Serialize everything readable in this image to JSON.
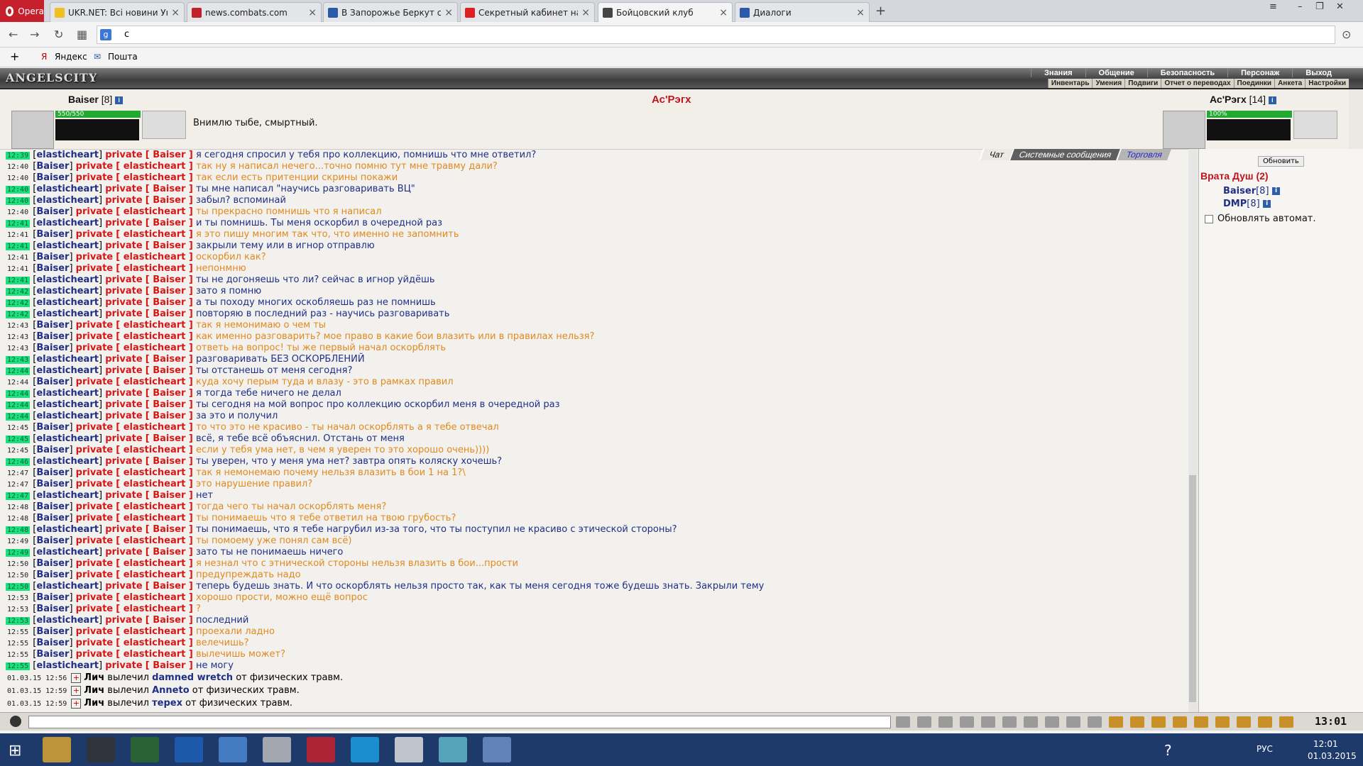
{
  "browser": {
    "opera_label": "Opera",
    "tabs": [
      {
        "title": "UKR.NET: Всі новини Укр",
        "color": "#f0c020"
      },
      {
        "title": "news.combats.com",
        "color": "#c0202a"
      },
      {
        "title": "В Запорожье Беркут с ав",
        "color": "#2c5aa8"
      },
      {
        "title": "Секретный кабинет нача",
        "color": "#e02020"
      },
      {
        "title": "Бойцовский клуб",
        "color": "#444444"
      },
      {
        "title": "Диалоги",
        "color": "#2c5aa8"
      }
    ],
    "url": "c",
    "bookmarks": [
      "Яндекс",
      "Пошта"
    ]
  },
  "game": {
    "logo": "ANGELSCITY",
    "menu_top": [
      "Знания",
      "Общение",
      "Безопасность",
      "Персонаж",
      "Выход"
    ],
    "menu_bottom": [
      "Инвентарь",
      "Умения",
      "Подвиги",
      "Отчет о переводах",
      "Поединки",
      "Анкета",
      "Настройки"
    ],
    "player": {
      "name": "Baiser",
      "level": "[8]",
      "hp": "550/550",
      "hp_fraction": 1.0
    },
    "opponent": {
      "name": "Ас'Рэгх",
      "level": "[14]",
      "hp": "100%",
      "hp_fraction": 1.0
    },
    "quote": "Внимлю тыбе, смыртный."
  },
  "chat": {
    "tabs": [
      "Чат",
      "Системные сообщения",
      "Торговля"
    ],
    "lines": [
      {
        "t": "12:39",
        "g": true,
        "from": "elasticheart",
        "to": "Baiser",
        "text": "я сегодня спросил у тебя про коллекцию, помнишь что мне ответил?"
      },
      {
        "t": "12:40",
        "g": false,
        "from": "Baiser",
        "to": "elasticheart",
        "text": "так ну я написал нечего...точно помню тут мне травму дали?"
      },
      {
        "t": "12:40",
        "g": false,
        "from": "Baiser",
        "to": "elasticheart",
        "text": "так если есть притенции скрины покажи"
      },
      {
        "t": "12:40",
        "g": true,
        "from": "elasticheart",
        "to": "Baiser",
        "text": "ты мне написал \"научись разговаривать ВЦ\""
      },
      {
        "t": "12:40",
        "g": true,
        "from": "elasticheart",
        "to": "Baiser",
        "text": "забыл? вспоминай"
      },
      {
        "t": "12:40",
        "g": false,
        "from": "Baiser",
        "to": "elasticheart",
        "text": "ты прекрасно помнишь что я написал"
      },
      {
        "t": "12:41",
        "g": true,
        "from": "elasticheart",
        "to": "Baiser",
        "text": "и ты помнишь. Ты меня оскорбил в очередной раз"
      },
      {
        "t": "12:41",
        "g": false,
        "from": "Baiser",
        "to": "elasticheart",
        "text": "я это пишу многим так что, что именно не запомнить"
      },
      {
        "t": "12:41",
        "g": true,
        "from": "elasticheart",
        "to": "Baiser",
        "text": "закрыли тему или в игнор отправлю"
      },
      {
        "t": "12:41",
        "g": false,
        "from": "Baiser",
        "to": "elasticheart",
        "text": "оскорбил как?"
      },
      {
        "t": "12:41",
        "g": false,
        "from": "Baiser",
        "to": "elasticheart",
        "text": "непонмню"
      },
      {
        "t": "12:41",
        "g": true,
        "from": "elasticheart",
        "to": "Baiser",
        "text": "ты не догоняешь что ли? сейчас в игнор уйдёшь"
      },
      {
        "t": "12:42",
        "g": true,
        "from": "elasticheart",
        "to": "Baiser",
        "text": "зато я помню"
      },
      {
        "t": "12:42",
        "g": true,
        "from": "elasticheart",
        "to": "Baiser",
        "text": "а ты походу многих оскобляешь раз не помнишь"
      },
      {
        "t": "12:42",
        "g": true,
        "from": "elasticheart",
        "to": "Baiser",
        "text": "повторяю в последний раз - научись разговаривать"
      },
      {
        "t": "12:43",
        "g": false,
        "from": "Baiser",
        "to": "elasticheart",
        "text": "так я немонимаю о чем ты"
      },
      {
        "t": "12:43",
        "g": false,
        "from": "Baiser",
        "to": "elasticheart",
        "text": "как именно разговарить? мое право в какие бои влазить или в правилах нельзя?"
      },
      {
        "t": "12:43",
        "g": false,
        "from": "Baiser",
        "to": "elasticheart",
        "text": "ответь на вопрос! ты же первый начал оскорблять"
      },
      {
        "t": "12:43",
        "g": true,
        "from": "elasticheart",
        "to": "Baiser",
        "text": "разговаривать БЕЗ ОСКОРБЛЕНИЙ"
      },
      {
        "t": "12:44",
        "g": true,
        "from": "elasticheart",
        "to": "Baiser",
        "text": "ты отстанешь от меня сегодня?"
      },
      {
        "t": "12:44",
        "g": false,
        "from": "Baiser",
        "to": "elasticheart",
        "text": "куда хочу перым туда и влазу - это в рамках правил"
      },
      {
        "t": "12:44",
        "g": true,
        "from": "elasticheart",
        "to": "Baiser",
        "text": "я тогда тебе ничего не делал"
      },
      {
        "t": "12:44",
        "g": true,
        "from": "elasticheart",
        "to": "Baiser",
        "text": "ты сегодня на мой вопрос про коллекцию оскорбил меня в очередной раз"
      },
      {
        "t": "12:44",
        "g": true,
        "from": "elasticheart",
        "to": "Baiser",
        "text": "за это и получил"
      },
      {
        "t": "12:45",
        "g": false,
        "from": "Baiser",
        "to": "elasticheart",
        "text": "то что это не красиво - ты начал оскорблять а я тебе отвечал"
      },
      {
        "t": "12:45",
        "g": true,
        "from": "elasticheart",
        "to": "Baiser",
        "text": "всё, я тебе всё объяснил. Отстань от меня"
      },
      {
        "t": "12:45",
        "g": false,
        "from": "Baiser",
        "to": "elasticheart",
        "text": "если у тебя ума нет, в чем я уверен то это хорошо очень))))"
      },
      {
        "t": "12:46",
        "g": true,
        "from": "elasticheart",
        "to": "Baiser",
        "text": "ты уверен, что у меня ума нет? завтра опять коляску хочешь?"
      },
      {
        "t": "12:47",
        "g": false,
        "from": "Baiser",
        "to": "elasticheart",
        "text": "так я немонемаю почему нельзя влазить в бои 1 на 1?\\"
      },
      {
        "t": "12:47",
        "g": false,
        "from": "Baiser",
        "to": "elasticheart",
        "text": "это нарушение правил?"
      },
      {
        "t": "12:47",
        "g": true,
        "from": "elasticheart",
        "to": "Baiser",
        "text": "нет"
      },
      {
        "t": "12:48",
        "g": false,
        "from": "Baiser",
        "to": "elasticheart",
        "text": "тогда чего ты начал оскорблять меня?"
      },
      {
        "t": "12:48",
        "g": false,
        "from": "Baiser",
        "to": "elasticheart",
        "text": "ты понимаешь что я тебе ответил на твою грубость?"
      },
      {
        "t": "12:48",
        "g": true,
        "from": "elasticheart",
        "to": "Baiser",
        "text": "ты понимаешь, что я тебе нагрубил из-за того, что ты поступил не красиво с этической стороны?"
      },
      {
        "t": "12:49",
        "g": false,
        "from": "Baiser",
        "to": "elasticheart",
        "text": "ты помоему уже понял сам всё)"
      },
      {
        "t": "12:49",
        "g": true,
        "from": "elasticheart",
        "to": "Baiser",
        "text": "зато ты не понимаешь ничего"
      },
      {
        "t": "12:50",
        "g": false,
        "from": "Baiser",
        "to": "elasticheart",
        "text": "я незнал что с этнической стороны нельзя влазить в бои...прости"
      },
      {
        "t": "12:50",
        "g": false,
        "from": "Baiser",
        "to": "elasticheart",
        "text": "предупреждать надо"
      },
      {
        "t": "12:50",
        "g": true,
        "from": "elasticheart",
        "to": "Baiser",
        "text": "теперь будешь знать. И что оскорблять нельзя просто так, как ты меня сегодня тоже будешь знать. Закрыли тему"
      },
      {
        "t": "12:53",
        "g": false,
        "from": "Baiser",
        "to": "elasticheart",
        "text": "хорошо прости, можно ещё вопрос"
      },
      {
        "t": "12:53",
        "g": false,
        "from": "Baiser",
        "to": "elasticheart",
        "text": "?"
      },
      {
        "t": "12:53",
        "g": true,
        "from": "elasticheart",
        "to": "Baiser",
        "text": "последний"
      },
      {
        "t": "12:55",
        "g": false,
        "from": "Baiser",
        "to": "elasticheart",
        "text": "проехали ладно"
      },
      {
        "t": "12:55",
        "g": false,
        "from": "Baiser",
        "to": "elasticheart",
        "text": "велечишь?"
      },
      {
        "t": "12:55",
        "g": false,
        "from": "Baiser",
        "to": "elasticheart",
        "text": "вылечишь может?"
      },
      {
        "t": "12:55",
        "g": true,
        "from": "elasticheart",
        "to": "Baiser",
        "text": "не могу"
      }
    ],
    "private_label": "private",
    "system": [
      {
        "t": "01.03.15 12:56",
        "actor": "Лич",
        "verb": "вылечил",
        "target": "damned wretch",
        "tail": "от физических травм."
      },
      {
        "t": "01.03.15 12:59",
        "actor": "Лич",
        "verb": "вылечил",
        "target": "Anneto",
        "tail": "от физических травм."
      },
      {
        "t": "01.03.15 12:59",
        "actor": "Лич",
        "verb": "вылечил",
        "target": "терех",
        "tail": "от физических травм."
      }
    ]
  },
  "sidebar": {
    "refresh": "Обновить",
    "location": "Врата Душ (2)",
    "users": [
      {
        "name": "Baiser",
        "lvl": "[8]"
      },
      {
        "name": "DMP",
        "lvl": "[8]"
      }
    ],
    "auto_refresh": "Обновлять автомат."
  },
  "gameclock": "13:01",
  "taskbar": {
    "lang": "РУС",
    "time": "12:01",
    "date": "01.03.2015"
  }
}
